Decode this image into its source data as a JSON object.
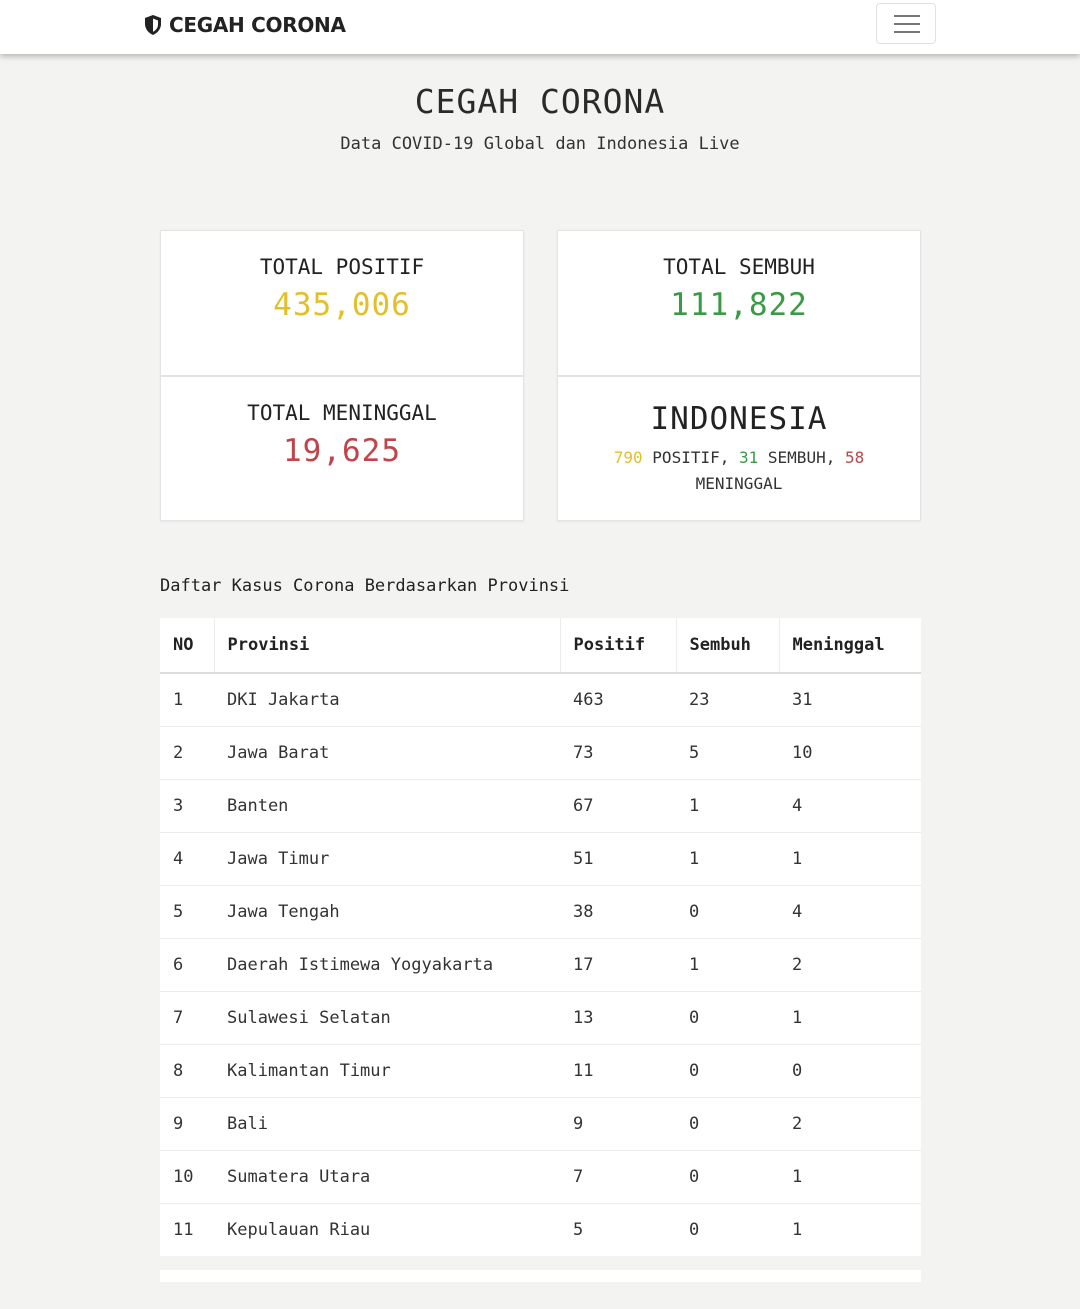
{
  "navbar": {
    "brand": "CEGAH CORONA",
    "brand_icon": "shield-icon",
    "toggler_icon": "hamburger-menu-icon"
  },
  "hero": {
    "title": "CEGAH CORONA",
    "subtitle": "Data COVID-19 Global dan Indonesia Live"
  },
  "cards": {
    "positif": {
      "label": "TOTAL POSITIF",
      "value": "435,006",
      "color": "#e3c02a"
    },
    "sembuh": {
      "label": "TOTAL SEMBUH",
      "value": "111,822",
      "color": "#3a9a45"
    },
    "meninggal": {
      "label": "TOTAL MENINGGAL",
      "value": "19,625",
      "color": "#c0454a"
    },
    "indonesia": {
      "title": "INDONESIA",
      "positif_value": "790",
      "positif_label": "POSITIF,",
      "sembuh_value": "31",
      "sembuh_label": "SEMBUH,",
      "meninggal_value": "58",
      "meninggal_label": "MENINGGAL"
    }
  },
  "table": {
    "title": "Daftar Kasus Corona Berdasarkan Provinsi",
    "headers": [
      "NO",
      "Provinsi",
      "Positif",
      "Sembuh",
      "Meninggal"
    ],
    "rows": [
      [
        "1",
        "DKI Jakarta",
        "463",
        "23",
        "31"
      ],
      [
        "2",
        "Jawa Barat",
        "73",
        "5",
        "10"
      ],
      [
        "3",
        "Banten",
        "67",
        "1",
        "4"
      ],
      [
        "4",
        "Jawa Timur",
        "51",
        "1",
        "1"
      ],
      [
        "5",
        "Jawa Tengah",
        "38",
        "0",
        "4"
      ],
      [
        "6",
        "Daerah Istimewa Yogyakarta",
        "17",
        "1",
        "2"
      ],
      [
        "7",
        "Sulawesi Selatan",
        "13",
        "0",
        "1"
      ],
      [
        "8",
        "Kalimantan Timur",
        "11",
        "0",
        "0"
      ],
      [
        "9",
        "Bali",
        "9",
        "0",
        "2"
      ],
      [
        "10",
        "Sumatera Utara",
        "7",
        "0",
        "1"
      ],
      [
        "11",
        "Kepulauan Riau",
        "5",
        "0",
        "1"
      ]
    ]
  }
}
